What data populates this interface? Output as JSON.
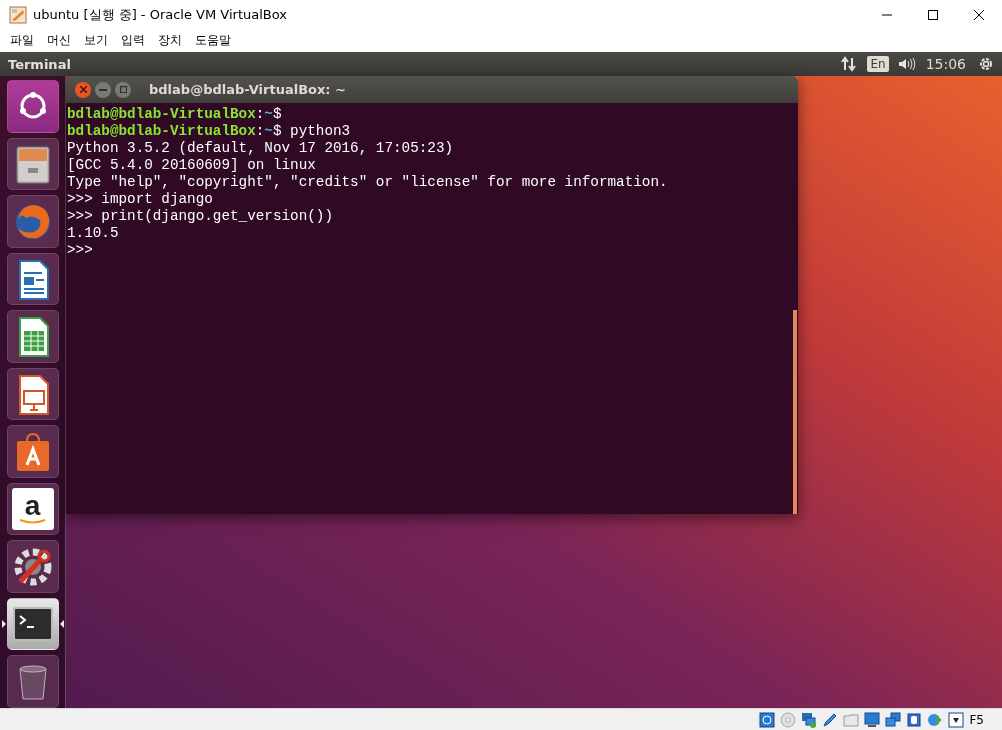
{
  "window": {
    "title": "ubuntu [실행 중] - Oracle VM VirtualBox",
    "controls": [
      {
        "kind": "minimize"
      },
      {
        "kind": "maximize"
      },
      {
        "kind": "close"
      }
    ]
  },
  "menu": [
    "파일",
    "머신",
    "보기",
    "입력",
    "장치",
    "도움말"
  ],
  "top_panel": {
    "app_name": "Terminal",
    "keyboard_layout": "En",
    "clock": "15:06"
  },
  "launcher": [
    {
      "kind": "dash",
      "selected": false
    },
    {
      "kind": "files",
      "selected": false
    },
    {
      "kind": "firefox",
      "selected": false
    },
    {
      "kind": "writer",
      "selected": false
    },
    {
      "kind": "calc",
      "selected": false
    },
    {
      "kind": "impress",
      "selected": false
    },
    {
      "kind": "software",
      "selected": false
    },
    {
      "kind": "amazon",
      "selected": false,
      "glyph": "a"
    },
    {
      "kind": "settings",
      "selected": false
    },
    {
      "kind": "terminal",
      "selected": true
    },
    {
      "kind": "trash",
      "selected": false
    }
  ],
  "terminal": {
    "title": "bdlab@bdlab-VirtualBox: ~",
    "lines": [
      {
        "kind": "prompt",
        "user": "bdlab@bdlab-VirtualBox",
        "colon": ":",
        "dir": "~",
        "symbol": "$"
      },
      {
        "kind": "prompt",
        "user": "bdlab@bdlab-VirtualBox",
        "colon": ":",
        "dir": "~",
        "symbol": "$",
        "command": "python3"
      },
      {
        "kind": "output",
        "text": "Python 3.5.2 (default, Nov 17 2016, 17:05:23)"
      },
      {
        "kind": "output",
        "text": "[GCC 5.4.0 20160609] on linux"
      },
      {
        "kind": "output",
        "text": "Type \"help\", \"copyright\", \"credits\" or \"license\" for more information."
      },
      {
        "kind": "output",
        "text": ">>> import django"
      },
      {
        "kind": "output",
        "text": ">>> print(django.get_version())"
      },
      {
        "kind": "output",
        "text": "1.10.5"
      },
      {
        "kind": "output",
        "text": ">>>"
      }
    ]
  },
  "status_bar": {
    "indicators": [
      {
        "kind": "hard-disk"
      },
      {
        "kind": "optical-disc"
      },
      {
        "kind": "network"
      },
      {
        "kind": "usb"
      },
      {
        "kind": "shared-folder"
      },
      {
        "kind": "display"
      },
      {
        "kind": "capture"
      },
      {
        "kind": "cpu"
      },
      {
        "kind": "globe"
      },
      {
        "kind": "mouse-integration"
      }
    ],
    "host_key": "F5"
  }
}
